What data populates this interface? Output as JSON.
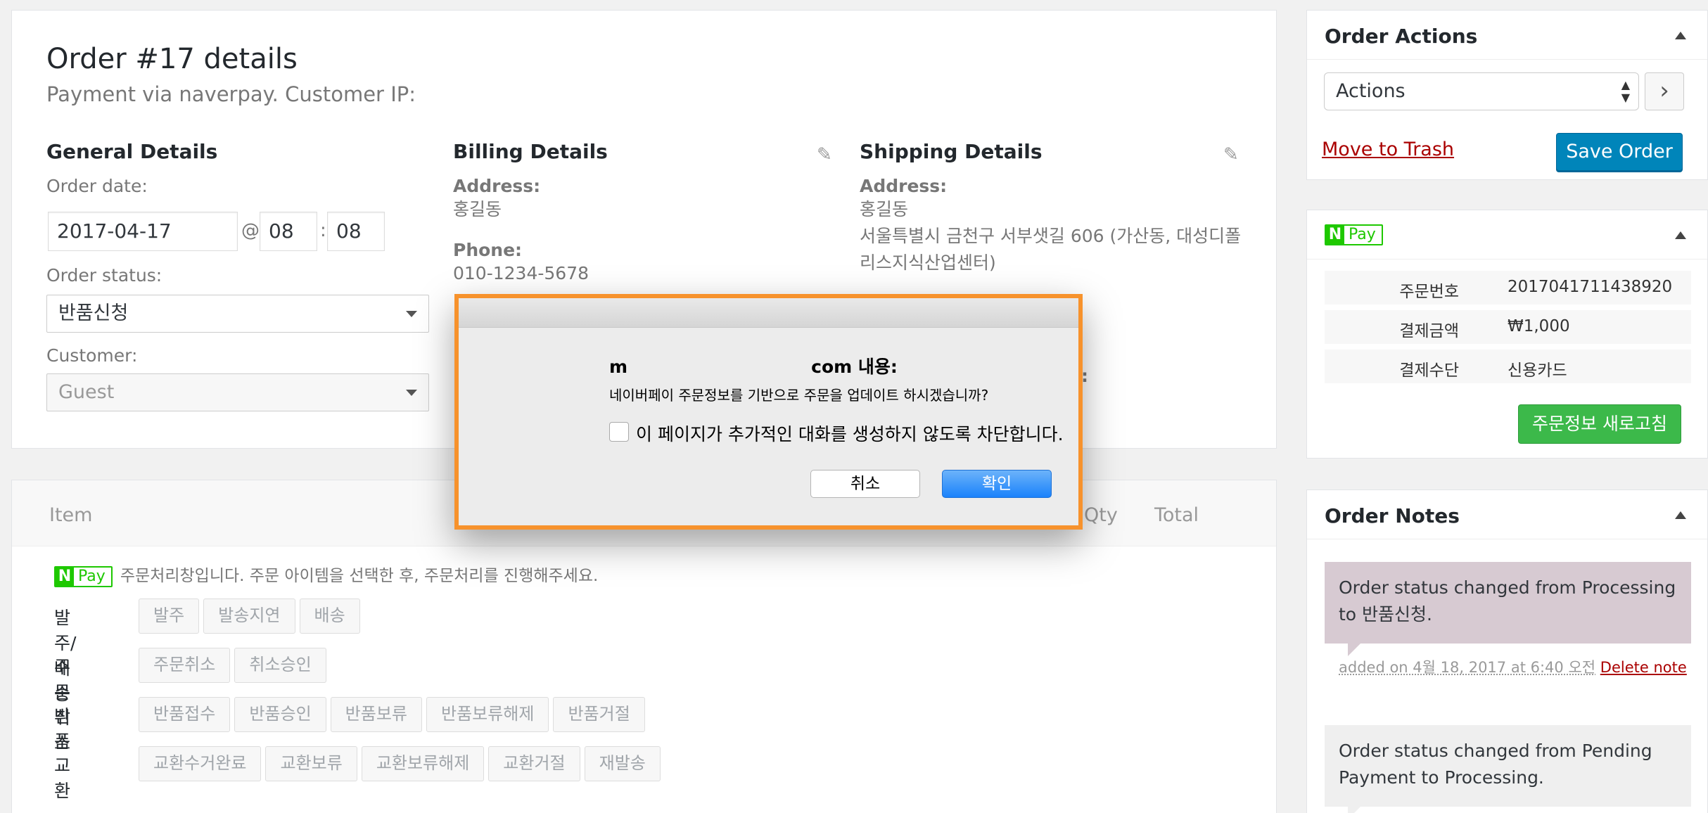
{
  "order": {
    "title": "Order #17 details",
    "subtitle": "Payment via naverpay. Customer IP:"
  },
  "general": {
    "heading": "General Details",
    "order_date_label": "Order date:",
    "date_value": "2017-04-17",
    "at": "@",
    "hour": "08",
    "colon": ":",
    "minute": "08",
    "status_label": "Order status:",
    "status_value": "반품신청",
    "customer_label": "Customer:",
    "customer_value": "Guest"
  },
  "billing": {
    "heading": "Billing Details",
    "address_label": "Address:",
    "address_value": "홍길동",
    "phone_label": "Phone:",
    "phone_value": "010-1234-5678"
  },
  "shipping": {
    "heading": "Shipping Details",
    "address_label": "Address:",
    "address_line1": "홍길동",
    "address_line2": "서울특별시 금천구 서부샛길 606 (가산동, 대성디폴",
    "address_line3": "리스지식산업센터)",
    "partial": ":"
  },
  "items": {
    "col_item": "Item",
    "col_qty": "Qty",
    "col_total": "Total",
    "npay_text": "Pay",
    "npay_n": "N",
    "npay_notice": "주문처리창입니다. 주문 아이템을 선택한 후, 주문처리를 진행해주세요.",
    "rows": [
      {
        "label": "발주/배송",
        "buttons": [
          "발주",
          "발송지연",
          "배송"
        ]
      },
      {
        "label": "주문취소",
        "buttons": [
          "주문취소",
          "취소승인"
        ]
      },
      {
        "label": "반품",
        "buttons": [
          "반품접수",
          "반품승인",
          "반품보류",
          "반품보류해제",
          "반품거절"
        ]
      },
      {
        "label": "교환",
        "buttons": [
          "교환수거완료",
          "교환보류",
          "교환보류해제",
          "교환거절",
          "재발송"
        ]
      }
    ]
  },
  "order_actions": {
    "heading": "Order Actions",
    "select_value": "Actions",
    "go": "›",
    "trash": "Move to Trash",
    "save": "Save Order"
  },
  "npay_box": {
    "n": "N",
    "pay": "Pay",
    "rows": [
      {
        "k": "주문번호",
        "v": "2017041711438920"
      },
      {
        "k": "결제금액",
        "v": "₩1,000"
      },
      {
        "k": "결제수단",
        "v": "신용카드"
      }
    ],
    "refresh": "주문정보 새로고침"
  },
  "notes": {
    "heading": "Order Notes",
    "note1": "Order status changed from Processing to 반품신청.",
    "note1_meta": "added on 4월 18, 2017 at 6:40 오전",
    "note1_delete": "Delete note",
    "note2": "Order status changed from Pending Payment to Processing."
  },
  "dialog": {
    "title": "m                              com 내용:",
    "message": "네이버페이 주문정보를 기반으로 주문을 업데이트 하시겠습니까?",
    "checkbox_label": "이 페이지가 추가적인 대화를 생성하지 않도록 차단합니다.",
    "cancel": "취소",
    "ok": "확인"
  },
  "colors": {
    "accent": "#0085ba",
    "naver_green": "#1ec800",
    "dialog_highlight": "#f7922c"
  }
}
